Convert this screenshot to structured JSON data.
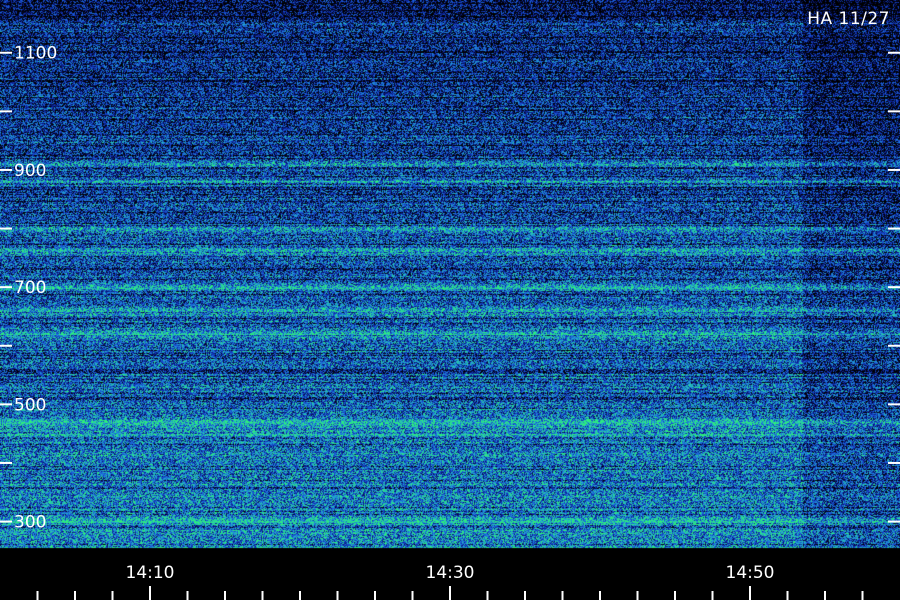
{
  "title": "HA 11/27",
  "chart_data": {
    "type": "heatmap",
    "x": {
      "range_minutes": [
        14.0,
        15.0
      ],
      "tick_labels": [
        "14:10",
        "14:30",
        "14:50"
      ],
      "tick_label_minutes": [
        10,
        30,
        50
      ],
      "minor_tick_step_minutes": 2.5
    },
    "y": {
      "range": [
        260,
        1190
      ],
      "tick_labels": [
        "1100",
        "900",
        "700",
        "500",
        "300"
      ],
      "tick_label_values": [
        1100,
        900,
        700,
        500,
        300
      ],
      "minor_tick_values": [
        1000,
        800,
        600,
        400
      ]
    },
    "colormap": [
      "#000000",
      "#0b1c8a",
      "#1a54d8",
      "#22a6d4",
      "#2df07a"
    ],
    "bright_band_values": [
      300,
      450,
      470,
      620,
      660,
      700,
      760,
      800,
      880,
      910
    ],
    "gap_after_minutes": 53.5
  }
}
